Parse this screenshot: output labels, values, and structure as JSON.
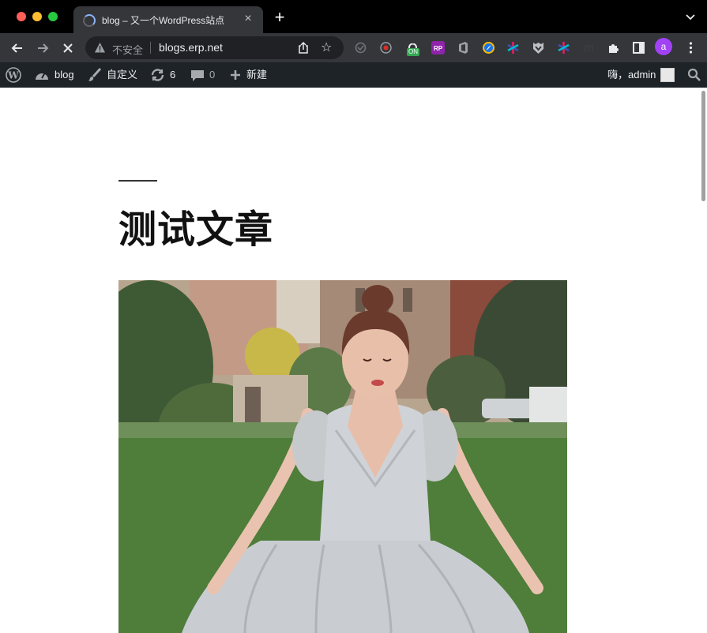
{
  "browser": {
    "tab": {
      "title": "blog – 又一个WordPress站点"
    },
    "omnibox": {
      "security_label": "不安全",
      "url": "blogs.erp.net"
    },
    "extensions": [
      {
        "name": "sync-icon",
        "color": "#5f6368"
      },
      {
        "name": "record-icon",
        "color": "#d93025"
      },
      {
        "name": "on-badge-extension",
        "badge": "ON",
        "color": "#34a853"
      },
      {
        "name": "rp-extension",
        "badge": "RP",
        "color": "#8e24aa"
      },
      {
        "name": "office-icon",
        "color": "#9aa0a6"
      },
      {
        "name": "compass-icon",
        "color": "#1a73e8"
      },
      {
        "name": "asterisk-icon",
        "color": "#e91e63"
      },
      {
        "name": "shield-icon",
        "color": "#bdc1c6"
      },
      {
        "name": "asterisk-icon-2",
        "color": "#e91e63"
      },
      {
        "name": "m-icon",
        "color": "#3c4043"
      },
      {
        "name": "puzzle-icon",
        "color": "#e8eaed"
      }
    ],
    "profile": {
      "initial": "a"
    }
  },
  "admin_bar": {
    "site_name": "blog",
    "customize": "自定义",
    "updates_count": "6",
    "comments_count": "0",
    "new_label": "新建",
    "greeting": "嗨，admin"
  },
  "post": {
    "title": "测试文章",
    "featured_image": {
      "alt": "woman in white sparkling ball gown on lawn"
    }
  },
  "colors": {
    "admin_bar_bg": "#1d2327",
    "toolbar_bg": "#35363a",
    "accent": "#8ab4f8"
  }
}
